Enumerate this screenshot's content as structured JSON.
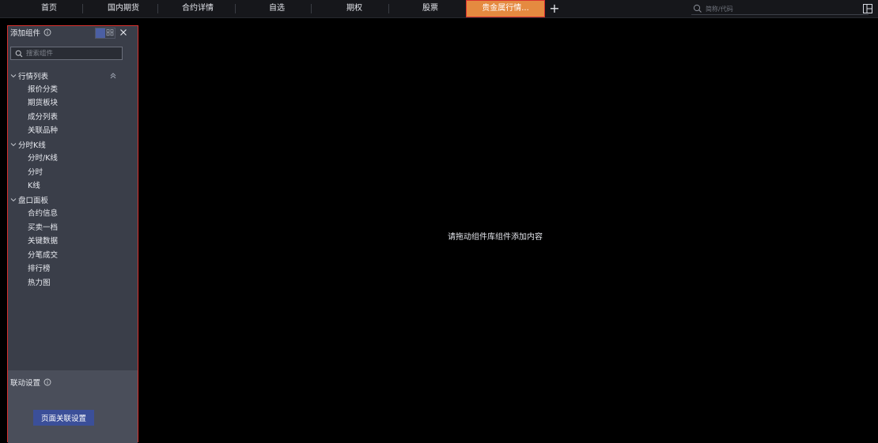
{
  "nav": {
    "tabs": [
      {
        "label": "首页"
      },
      {
        "label": "国内期货"
      },
      {
        "label": "合约详情"
      },
      {
        "label": "自选"
      },
      {
        "label": "期权"
      },
      {
        "label": "股票"
      },
      {
        "label": "贵金属行情..."
      }
    ],
    "add_tab_label": "+",
    "search_placeholder": "简称/代码",
    "active_color": "#e58a40"
  },
  "panel": {
    "title": "添加组件",
    "search_placeholder": "搜索组件",
    "groups": [
      {
        "label": "行情列表",
        "items": [
          "报价分类",
          "期货板块",
          "成分列表",
          "关联品种"
        ]
      },
      {
        "label": "分时K线",
        "items": [
          "分时/K线",
          "分时",
          "K线"
        ]
      },
      {
        "label": "盘口面板",
        "items": [
          "合约信息",
          "买卖一档",
          "关键数据",
          "分笔成交",
          "排行榜",
          "热力图"
        ]
      }
    ],
    "link_settings": {
      "title": "联动设置",
      "button_label": "页面关联设置"
    }
  },
  "main": {
    "empty_hint": "请拖动组件库组件添加内容"
  },
  "icons": {
    "search": "search-icon",
    "info": "info-icon",
    "close": "close-icon",
    "chevron": "chevron-down-icon",
    "collapse": "double-chevron-up-icon",
    "layout": "layout-icon"
  }
}
